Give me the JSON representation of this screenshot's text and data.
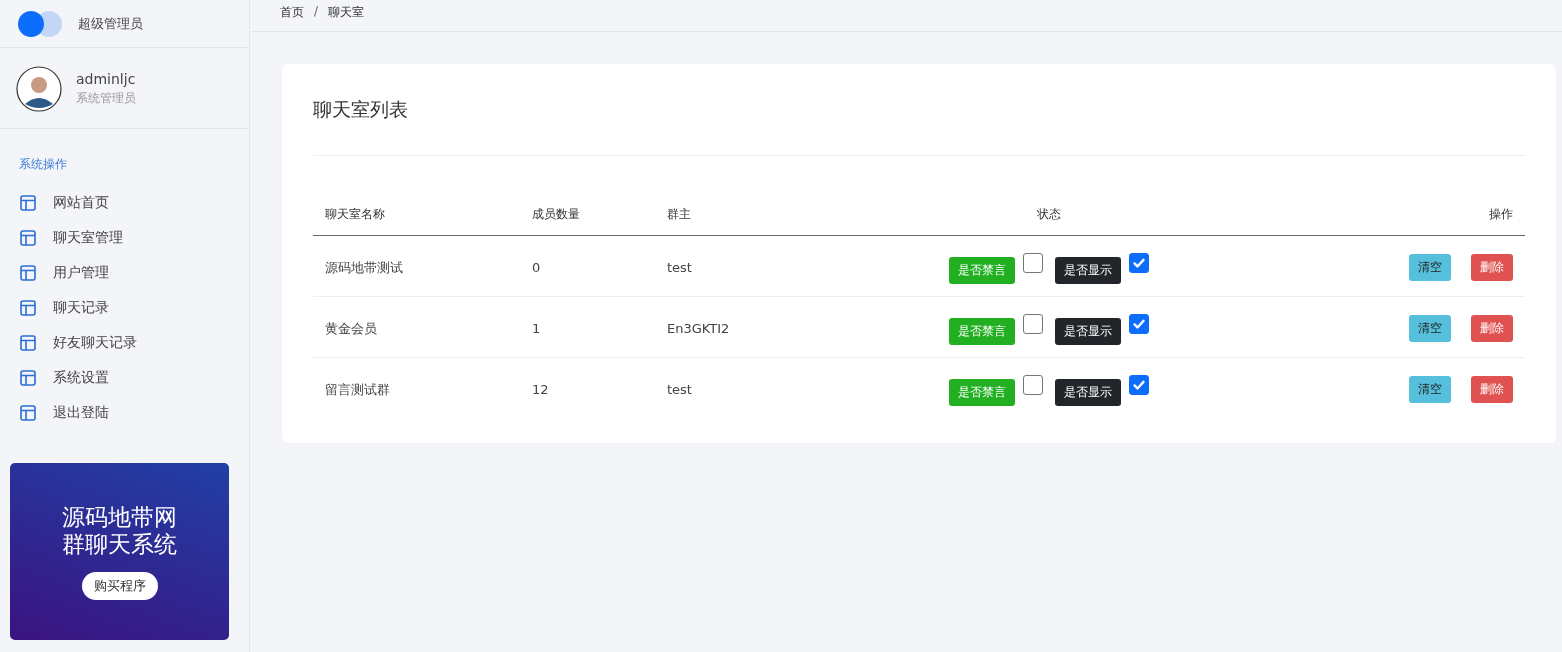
{
  "brand": {
    "title": "超级管理员"
  },
  "user": {
    "name": "adminljc",
    "role": "系统管理员"
  },
  "sidebar": {
    "section": "系统操作",
    "items": [
      {
        "label": "网站首页",
        "selected": false
      },
      {
        "label": "聊天室管理",
        "selected": false
      },
      {
        "label": "用户管理",
        "selected": false
      },
      {
        "label": "聊天记录",
        "selected": false
      },
      {
        "label": "好友聊天记录",
        "selected": false
      },
      {
        "label": "系统设置",
        "selected": false
      },
      {
        "label": "退出登陆",
        "selected": false
      }
    ]
  },
  "promo": {
    "title_lines": [
      "源码地带网",
      "群聊天系统"
    ],
    "button": "购买程序"
  },
  "breadcrumb": [
    "首页",
    "聊天室"
  ],
  "breadcrumb_separator": "/",
  "card": {
    "title": "聊天室列表"
  },
  "table": {
    "columns": [
      "聊天室名称",
      "成员数量",
      "群主",
      "状态",
      "操作"
    ],
    "rows": [
      {
        "name": "源码地带测试",
        "members": "0",
        "owner": "test",
        "mute_label": "是否禁言",
        "muted": false,
        "show_label": "是否显示",
        "shown": true,
        "actions": [
          "清空",
          "删除"
        ]
      },
      {
        "name": "黄金会员",
        "members": "1",
        "owner": "En3GKTI2",
        "mute_label": "是否禁言",
        "muted": false,
        "show_label": "是否显示",
        "shown": true,
        "actions": [
          "清空",
          "删除"
        ]
      },
      {
        "name": "留言测试群",
        "members": "12",
        "owner": "test",
        "mute_label": "是否禁言",
        "muted": false,
        "show_label": "是否显示",
        "shown": true,
        "actions": [
          "清空",
          "删除"
        ]
      }
    ]
  }
}
